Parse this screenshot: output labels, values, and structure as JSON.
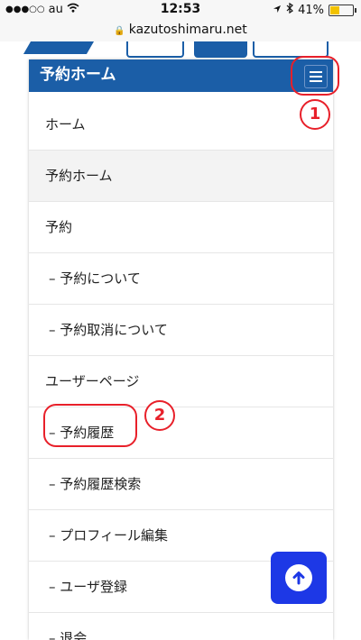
{
  "status_bar": {
    "carrier": "au",
    "time": "12:53",
    "battery": "41%",
    "battery_level": 0.41
  },
  "url_bar": {
    "url": "kazutoshimaru.net"
  },
  "menu": {
    "title": "予約ホーム",
    "items": [
      {
        "label": "ホーム"
      },
      {
        "label": "予約ホーム"
      },
      {
        "label": "予約"
      },
      {
        "label": "– 予約について"
      },
      {
        "label": "– 予約取消について"
      },
      {
        "label": "ユーザーページ"
      },
      {
        "label": "– 予約履歴"
      },
      {
        "label": "– 予約履歴検索"
      },
      {
        "label": "– プロフィール編集"
      },
      {
        "label": "– ユーザ登録"
      },
      {
        "label": "– 退会"
      }
    ]
  },
  "annotations": {
    "one": "1",
    "two": "2",
    "color": "#e8202a"
  },
  "colors": {
    "header_blue": "#1b5ea7",
    "scroll_button": "#1d38e6"
  }
}
